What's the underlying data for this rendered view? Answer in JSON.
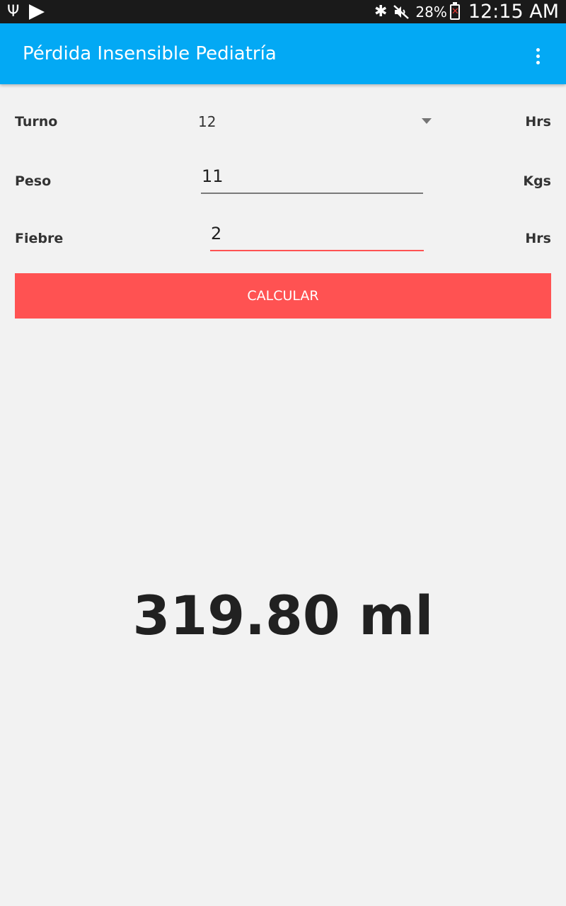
{
  "status_bar": {
    "battery_percent": "28%",
    "time": "12:15 AM",
    "icons": [
      "usb-icon",
      "play-store-icon",
      "bluetooth-icon",
      "mute-icon",
      "battery-icon"
    ]
  },
  "app_bar": {
    "title": "Pérdida Insensible Pediatría",
    "menu_icon": "overflow-menu-icon"
  },
  "form": {
    "turno": {
      "label": "Turno",
      "value": "12",
      "unit": "Hrs"
    },
    "peso": {
      "label": "Peso",
      "value": "11",
      "unit": "Kgs"
    },
    "fiebre": {
      "label": "Fiebre",
      "value": "2",
      "unit": "Hrs"
    }
  },
  "button": {
    "label": "CALCULAR"
  },
  "result": {
    "text": "319.80 ml"
  },
  "colors": {
    "app_bar": "#03a9f4",
    "accent": "#ff5252",
    "background": "#f2f2f2",
    "status_bar": "#1a1a1a"
  }
}
